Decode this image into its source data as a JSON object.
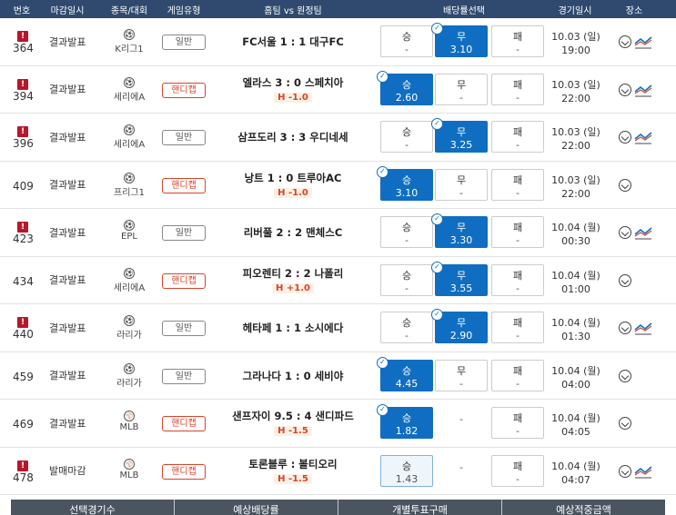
{
  "header": {
    "number": "번호",
    "deadline": "마감일시",
    "sport": "종목/대회",
    "game_type": "게임유형",
    "match": "홈팀 vs 원정팀",
    "odds": "배당률선택",
    "date": "경기일시",
    "place": "장소"
  },
  "rows": [
    {
      "alert": true,
      "num": "364",
      "deadline": "결과발표",
      "ball": "⚽",
      "league": "K리그1",
      "type": "일반",
      "handicap": false,
      "teams": "FC서울 1 : 1 대구FC",
      "hline": "",
      "win": {
        "label": "승",
        "value": "-"
      },
      "draw": {
        "label": "무",
        "value": "3.10"
      },
      "lose": {
        "label": "패",
        "value": "-"
      },
      "selected": "draw",
      "date": "10.03 (일)",
      "time": "19:00",
      "chart": true
    },
    {
      "alert": true,
      "num": "394",
      "deadline": "결과발표",
      "ball": "⚽",
      "league": "세리에A",
      "type": "핸디캡",
      "handicap": true,
      "teams": "엘라스 3 : 0 스페치아",
      "hline": "H -1.0",
      "win": {
        "label": "승",
        "value": "2.60"
      },
      "draw": {
        "label": "무",
        "value": "-"
      },
      "lose": {
        "label": "패",
        "value": "-"
      },
      "selected": "win",
      "date": "10.03 (일)",
      "time": "22:00",
      "chart": true
    },
    {
      "alert": true,
      "num": "396",
      "deadline": "결과발표",
      "ball": "⚽",
      "league": "세리에A",
      "type": "일반",
      "handicap": false,
      "teams": "삼프도리 3 : 3 우디네세",
      "hline": "",
      "win": {
        "label": "승",
        "value": "-"
      },
      "draw": {
        "label": "무",
        "value": "3.25"
      },
      "lose": {
        "label": "패",
        "value": "-"
      },
      "selected": "draw",
      "date": "10.03 (일)",
      "time": "22:00",
      "chart": true
    },
    {
      "alert": false,
      "num": "409",
      "deadline": "결과발표",
      "ball": "⚽",
      "league": "프리그1",
      "type": "핸디캡",
      "handicap": true,
      "teams": "낭트 1 : 0 트루아AC",
      "hline": "H -1.0",
      "win": {
        "label": "승",
        "value": "3.10"
      },
      "draw": {
        "label": "무",
        "value": "-"
      },
      "lose": {
        "label": "패",
        "value": "-"
      },
      "selected": "win",
      "date": "10.03 (일)",
      "time": "22:00",
      "chart": false
    },
    {
      "alert": true,
      "num": "423",
      "deadline": "결과발표",
      "ball": "⚽",
      "league": "EPL",
      "type": "일반",
      "handicap": false,
      "teams": "리버풀 2 : 2 맨체스C",
      "hline": "",
      "win": {
        "label": "승",
        "value": "-"
      },
      "draw": {
        "label": "무",
        "value": "3.30"
      },
      "lose": {
        "label": "패",
        "value": "-"
      },
      "selected": "draw",
      "date": "10.04 (월)",
      "time": "00:30",
      "chart": true
    },
    {
      "alert": false,
      "num": "434",
      "deadline": "결과발표",
      "ball": "⚽",
      "league": "세리에A",
      "type": "핸디캡",
      "handicap": true,
      "teams": "피오렌티 2 : 2 나폴리",
      "hline": "H +1.0",
      "win": {
        "label": "승",
        "value": "-"
      },
      "draw": {
        "label": "무",
        "value": "3.55"
      },
      "lose": {
        "label": "패",
        "value": "-"
      },
      "selected": "draw",
      "date": "10.04 (월)",
      "time": "01:00",
      "chart": false
    },
    {
      "alert": true,
      "num": "440",
      "deadline": "결과발표",
      "ball": "⚽",
      "league": "라리가",
      "type": "일반",
      "handicap": false,
      "teams": "헤타페 1 : 1 소시에다",
      "hline": "",
      "win": {
        "label": "승",
        "value": "-"
      },
      "draw": {
        "label": "무",
        "value": "2.90"
      },
      "lose": {
        "label": "패",
        "value": "-"
      },
      "selected": "draw",
      "date": "10.04 (월)",
      "time": "01:30",
      "chart": true
    },
    {
      "alert": false,
      "num": "459",
      "deadline": "결과발표",
      "ball": "⚽",
      "league": "라리가",
      "type": "일반",
      "handicap": false,
      "teams": "그라나다 1 : 0 세비야",
      "hline": "",
      "win": {
        "label": "승",
        "value": "4.45"
      },
      "draw": {
        "label": "무",
        "value": "-"
      },
      "lose": {
        "label": "패",
        "value": "-"
      },
      "selected": "win",
      "date": "10.04 (월)",
      "time": "04:00",
      "chart": false
    },
    {
      "alert": false,
      "num": "469",
      "deadline": "결과발표",
      "ball": "⚾",
      "league": "MLB",
      "type": "핸디캡",
      "handicap": true,
      "teams": "샌프자이 9.5 : 4 샌디파드",
      "hline": "H -1.5",
      "win": {
        "label": "승",
        "value": "1.82"
      },
      "draw": {
        "label": "",
        "value": "-"
      },
      "lose": {
        "label": "패",
        "value": "-"
      },
      "selected": "win",
      "no_draw": true,
      "date": "10.04 (월)",
      "time": "04:05",
      "chart": false
    },
    {
      "alert": true,
      "num": "478",
      "deadline": "발매마감",
      "ball": "⚾",
      "league": "MLB",
      "type": "핸디캡",
      "handicap": true,
      "teams": "토론블루 : 볼티오리",
      "hline": "H -1.5",
      "win": {
        "label": "승",
        "value": "1.43"
      },
      "draw": {
        "label": "",
        "value": "-"
      },
      "lose": {
        "label": "패",
        "value": "-"
      },
      "selected": "none",
      "highlight": "win",
      "no_draw": true,
      "date": "10.04 (월)",
      "time": "04:07",
      "chart": true
    }
  ],
  "footer": {
    "selected_count": "선택경기수",
    "expected_odds": "예상배당률",
    "individual_purchase": "개별투표구매",
    "expected_payout": "예상적중금액"
  },
  "colors": {
    "header_bg": "#2f4a6e",
    "selected_odd": "#0f6ec1",
    "alert": "#b8172a",
    "handicap": "#d9432a"
  }
}
